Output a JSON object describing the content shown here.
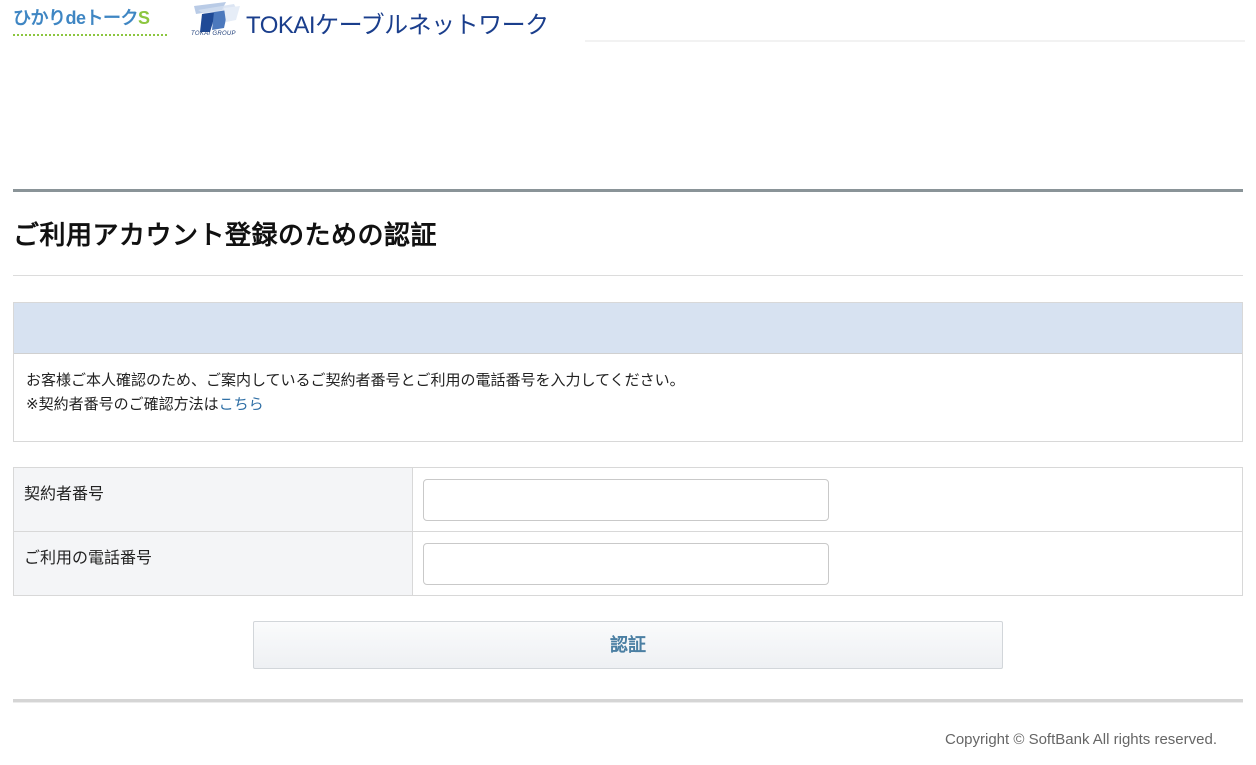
{
  "header": {
    "hikari_logo_text": "ひかりdeトーク",
    "hikari_logo_suffix": "S",
    "tokai_group_text": "TOKAI GROUP",
    "tokai_logo_text": "TOKAIケーブルネットワーク"
  },
  "page": {
    "title": "ご利用アカウント登録のための認証"
  },
  "info": {
    "line1": "お客様ご本人確認のため、ご案内しているご契約者番号とご利用の電話番号を入力してください。",
    "line2_prefix": "※契約者番号のご確認方法は",
    "line2_link": "こちら"
  },
  "form": {
    "fields": [
      {
        "label": "契約者番号",
        "value": "",
        "placeholder": ""
      },
      {
        "label": "ご利用の電話番号",
        "value": "",
        "placeholder": ""
      }
    ],
    "submit_label": "認証"
  },
  "footer": {
    "copyright": "Copyright © SoftBank All rights reserved."
  },
  "colors": {
    "info_header_bg": "#d7e2f1",
    "link": "#2f6fa5",
    "submit_text": "#4b7fa3",
    "tokai_brand": "#1a3e8c",
    "hikari_brand": "#3f86c3",
    "hikari_accent": "#8cc63f"
  }
}
